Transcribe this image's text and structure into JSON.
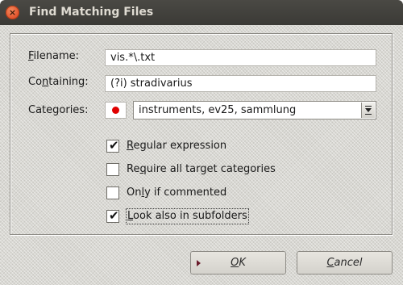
{
  "window": {
    "title": "Find Matching Files",
    "close_glyph": "×"
  },
  "form": {
    "filename": {
      "label_mnemonic": "F",
      "label_rest": "ilename:",
      "value": "vis.*\\.txt"
    },
    "containing": {
      "label_pre": "Co",
      "label_mnemonic": "n",
      "label_rest": "taining:",
      "value": "(?i) stradivarius"
    },
    "categories": {
      "label": "Categories:",
      "color": "#e00000",
      "selected": "instruments, ev25, sammlung"
    }
  },
  "options": [
    {
      "mnemonic": "R",
      "rest": "egular expression",
      "checked": true
    },
    {
      "pre": "Re",
      "mnemonic": "q",
      "rest": "uire all target categories",
      "checked": false
    },
    {
      "pre": "On",
      "mnemonic": "l",
      "rest": "y if commented",
      "checked": false
    },
    {
      "mnemonic": "L",
      "rest": "ook also in subfolders",
      "checked": true
    }
  ],
  "buttons": {
    "ok": {
      "mnemonic": "O",
      "rest": "K"
    },
    "cancel": {
      "mnemonic": "C",
      "rest": "ancel"
    }
  },
  "checkmark_glyph": "✔"
}
